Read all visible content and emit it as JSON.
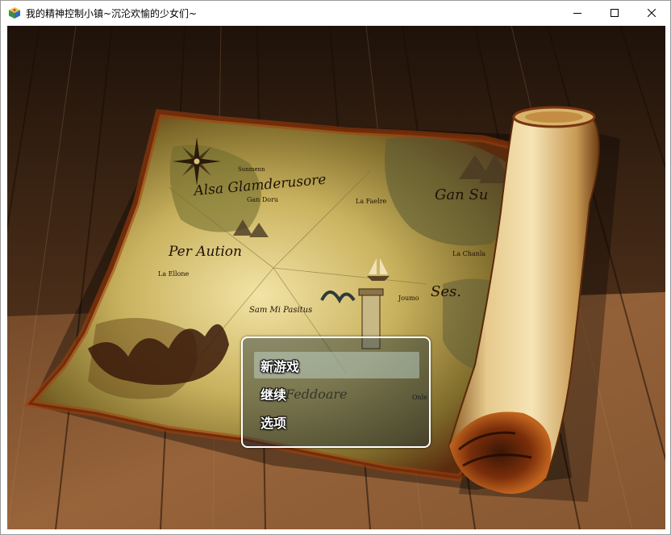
{
  "window": {
    "title": "我的精神控制小镇~沉沦欢愉的少女们~",
    "icon": "rpg-cube-icon",
    "controls": [
      "minimize-icon",
      "maximize-icon",
      "close-icon"
    ]
  },
  "map": {
    "labels": {
      "region1": "Alsa Glamderusore",
      "region2": "Gan Su",
      "region3": "Per Aution",
      "region4": "Ses.",
      "town1": "Gan Doru",
      "town2": "La Faelre",
      "town3": "La Chanla",
      "town4": "Sam Mi Pasitus",
      "town5": "Joumo",
      "town6": "Feddoare",
      "town7": "Onle",
      "town8": "La Ellone",
      "town9": "Sunmenn"
    }
  },
  "menu": {
    "items": [
      {
        "label": "新游戏",
        "selected": true
      },
      {
        "label": "继续",
        "selected": false
      },
      {
        "label": "选项",
        "selected": false
      }
    ]
  }
}
